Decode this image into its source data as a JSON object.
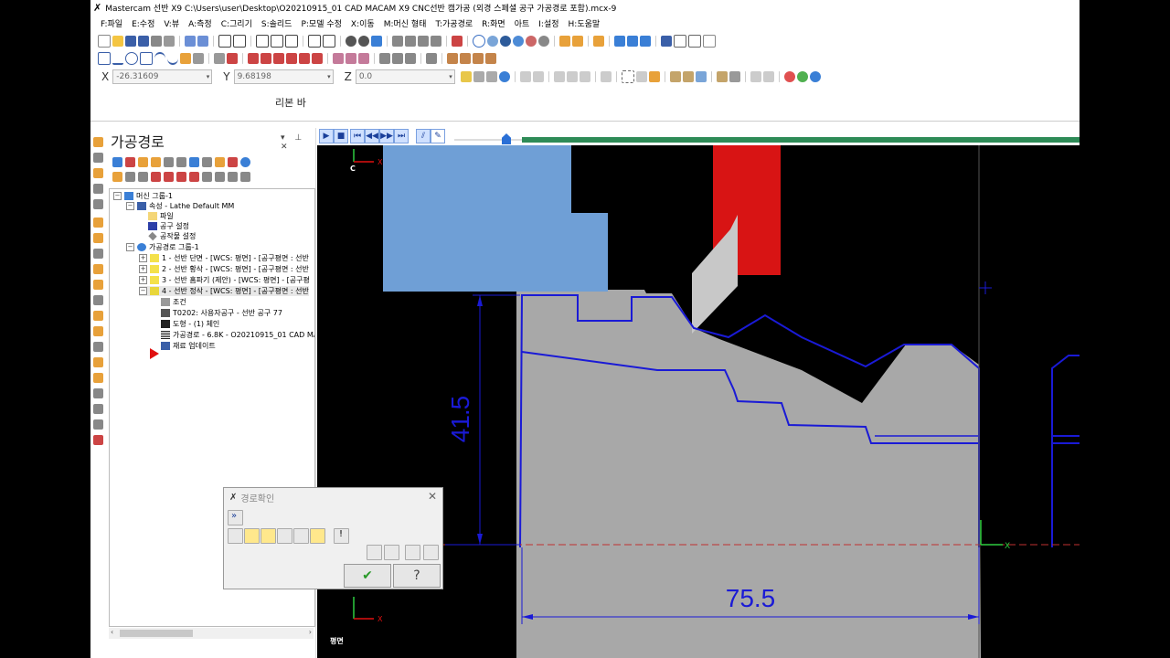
{
  "titlebar": {
    "text": "Mastercam 선반 X9  C:\\Users\\user\\Desktop\\O20210915_01 CAD MACAM X9 CNC선반 캠가공 (외경 스페셜 공구 가공경로 포함).mcx-9"
  },
  "menu": [
    "F:파일",
    "E:수정",
    "V:뷰",
    "A:측정",
    "C:그리기",
    "S:솔리드",
    "P:모델 수정",
    "X:이동",
    "M:머신 형태",
    "T:가공경로",
    "R:화면",
    "아트",
    "I:설정",
    "H:도움말"
  ],
  "coords": {
    "x_label": "X",
    "x_value": "-26.31609",
    "y_label": "Y",
    "y_value": "9.68198",
    "z_label": "Z",
    "z_value": "0.0"
  },
  "ribbon_label": "리본 바",
  "panel": {
    "title": "가공경로",
    "controls": "▾ ⊥ ✕"
  },
  "tree": {
    "machine_group": "머신 그룹-1",
    "properties": "속성 - Lathe Default MM",
    "files": "파일",
    "tool_settings": "공구 설정",
    "stock_settings": "공작물 설정",
    "toolpath_group": "가공경로 그룹-1",
    "ops": [
      "1 - 선반 단면 - [WCS: 평면] - [공구평면 : 선반",
      "2 - 선반 황삭 - [WCS: 평면] - [공구평면 : 선반",
      "3 - 선반 홈파기 (제안) - [WCS: 평면] - [공구평",
      "4 - 선반 정삭 - [WCS: 평면] - [공구평면 : 선반"
    ],
    "op4_children": {
      "params": "조건",
      "tool": "T0202: 사용자공구 - 선반 공구 77",
      "geometry": "도형 - (1) 체인",
      "toolpath": "가공경로 - 6.8K - O20210915_01 CAD MAC",
      "stock_update": "재료 업데이트"
    }
  },
  "viewport": {
    "dim_vertical": "41.5",
    "dim_horizontal": "75.5",
    "axis_c": "C",
    "axis_x": "X",
    "plane_label": "평면"
  },
  "dialog": {
    "title": "경로확인",
    "close": "✕",
    "ok": "✔",
    "help": "?"
  },
  "colors": {
    "stock_blue": "#6f9fd6",
    "chuck_red": "#d81414",
    "part_gray": "#a8a8a8",
    "toolpath_blue": "#1a1ad6",
    "progress_green": "#2e8b57"
  }
}
